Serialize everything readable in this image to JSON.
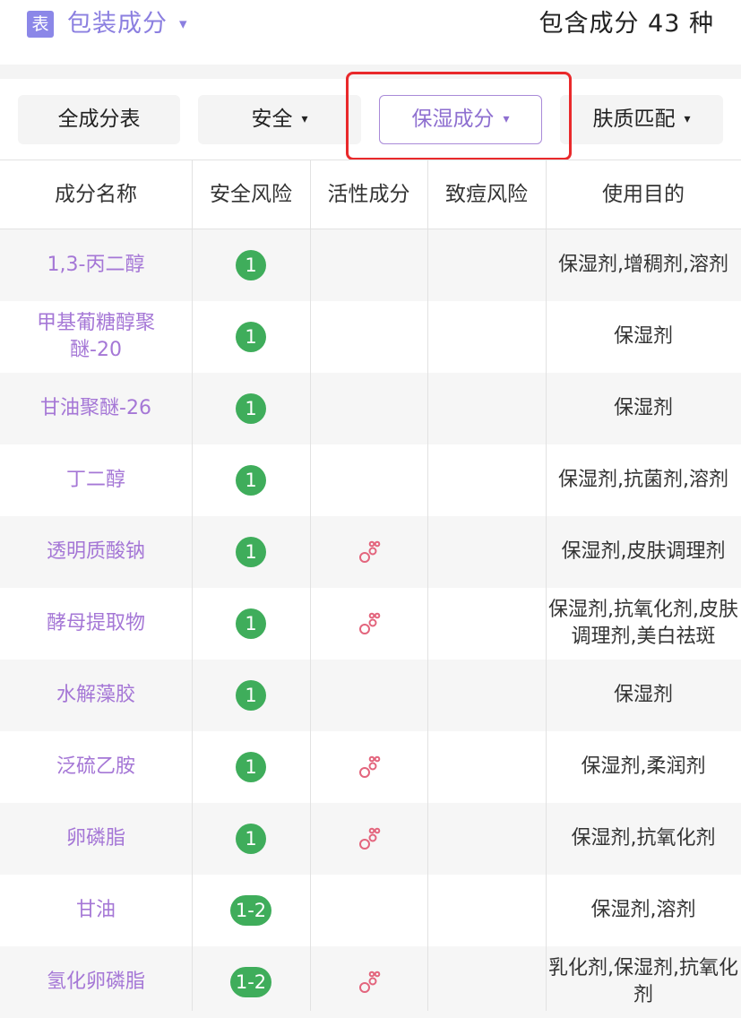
{
  "header": {
    "icon_label": "表",
    "title": "包装成分",
    "caret": "▾",
    "count_text": "包含成分 43 种"
  },
  "filters": [
    {
      "label": "全成分表",
      "caret": ""
    },
    {
      "label": "安全",
      "caret": "▾"
    },
    {
      "label": "保湿成分",
      "caret": "▾"
    },
    {
      "label": "肤质匹配",
      "caret": "▾"
    }
  ],
  "active_filter": "保湿成分",
  "table": {
    "columns": [
      "成分名称",
      "安全风险",
      "活性成分",
      "致痘风险",
      "使用目的"
    ],
    "rows": [
      {
        "name": "1,3-丙二醇",
        "risk": "1",
        "active": false,
        "acne": "",
        "purpose": "保湿剂,增稠剂,溶剂"
      },
      {
        "name": "甲基葡糖醇聚醚-20",
        "risk": "1",
        "active": false,
        "acne": "",
        "purpose": "保湿剂"
      },
      {
        "name": "甘油聚醚-26",
        "risk": "1",
        "active": false,
        "acne": "",
        "purpose": "保湿剂"
      },
      {
        "name": "丁二醇",
        "risk": "1",
        "active": false,
        "acne": "",
        "purpose": "保湿剂,抗菌剂,溶剂"
      },
      {
        "name": "透明质酸钠",
        "risk": "1",
        "active": true,
        "acne": "",
        "purpose": "保湿剂,皮肤调理剂"
      },
      {
        "name": "酵母提取物",
        "risk": "1",
        "active": true,
        "acne": "",
        "purpose": "保湿剂,抗氧化剂,皮肤调理剂,美白祛斑"
      },
      {
        "name": "水解藻胶",
        "risk": "1",
        "active": false,
        "acne": "",
        "purpose": "保湿剂"
      },
      {
        "name": "泛硫乙胺",
        "risk": "1",
        "active": true,
        "acne": "",
        "purpose": "保湿剂,柔润剂"
      },
      {
        "name": "卵磷脂",
        "risk": "1",
        "active": true,
        "acne": "",
        "purpose": "保湿剂,抗氧化剂"
      },
      {
        "name": "甘油",
        "risk": "1-2",
        "active": false,
        "acne": "",
        "purpose": "保湿剂,溶剂"
      },
      {
        "name": "氢化卵磷脂",
        "risk": "1-2",
        "active": true,
        "acne": "",
        "purpose": "乳化剂,保湿剂,抗氧化剂"
      }
    ]
  },
  "colors": {
    "accent": "#8b7fe0",
    "ingredient_name": "#a577d6",
    "risk_green": "#3fad5b",
    "active_icon": "#e3657d",
    "highlight_box": "#e9292b"
  }
}
